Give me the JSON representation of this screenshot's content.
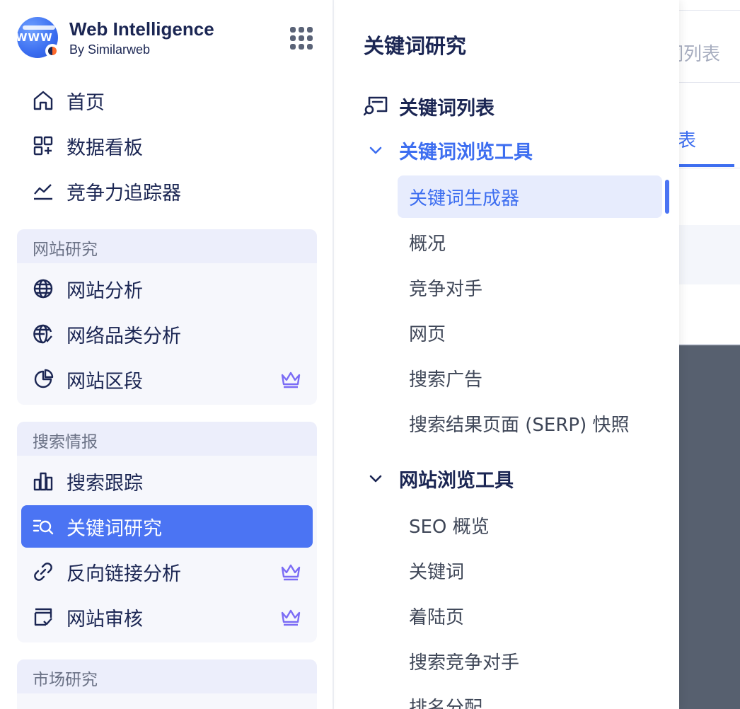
{
  "brand": {
    "title": "Web Intelligence",
    "subtitle": "By Similarweb",
    "logo_text": "WWW"
  },
  "nav_top": [
    {
      "label": "首页",
      "icon": "home-icon"
    },
    {
      "label": "数据看板",
      "icon": "dashboard-icon"
    },
    {
      "label": "竞争力追踪器",
      "icon": "trend-icon"
    }
  ],
  "groups": [
    {
      "title": "网站研究",
      "items": [
        {
          "label": "网站分析",
          "icon": "globe-icon",
          "premium": false
        },
        {
          "label": "网络品类分析",
          "icon": "globe-check-icon",
          "premium": false
        },
        {
          "label": "网站区段",
          "icon": "pie-chart-icon",
          "premium": true
        }
      ]
    },
    {
      "title": "搜索情报",
      "items": [
        {
          "label": "搜索跟踪",
          "icon": "bar-chart-icon",
          "premium": false
        },
        {
          "label": "关键词研究",
          "icon": "keyword-search-icon",
          "premium": false,
          "active": true
        },
        {
          "label": "反向链接分析",
          "icon": "link-icon",
          "premium": true
        },
        {
          "label": "网站审核",
          "icon": "audit-icon",
          "premium": true
        }
      ]
    },
    {
      "title": "市场研究",
      "items": []
    }
  ],
  "flyout": {
    "title": "关键词研究",
    "keyword_list": "关键词列表",
    "section1": {
      "title": "关键词浏览工具",
      "items": [
        "关键词生成器",
        "概况",
        "竞争对手",
        "网页",
        "搜索广告",
        "搜索结果页面 (SERP) 快照"
      ],
      "selected": "关键词生成器"
    },
    "section2": {
      "title": "网站浏览工具",
      "items": [
        "SEO 概览",
        "关键词",
        "着陆页",
        "搜索竞争对手",
        "排名分配"
      ]
    }
  },
  "background_page": {
    "tab1": "词列表",
    "tab2": "表"
  },
  "colors": {
    "accent": "#4b74f3",
    "text": "#1b2653",
    "premium": "#7b6cf5"
  }
}
